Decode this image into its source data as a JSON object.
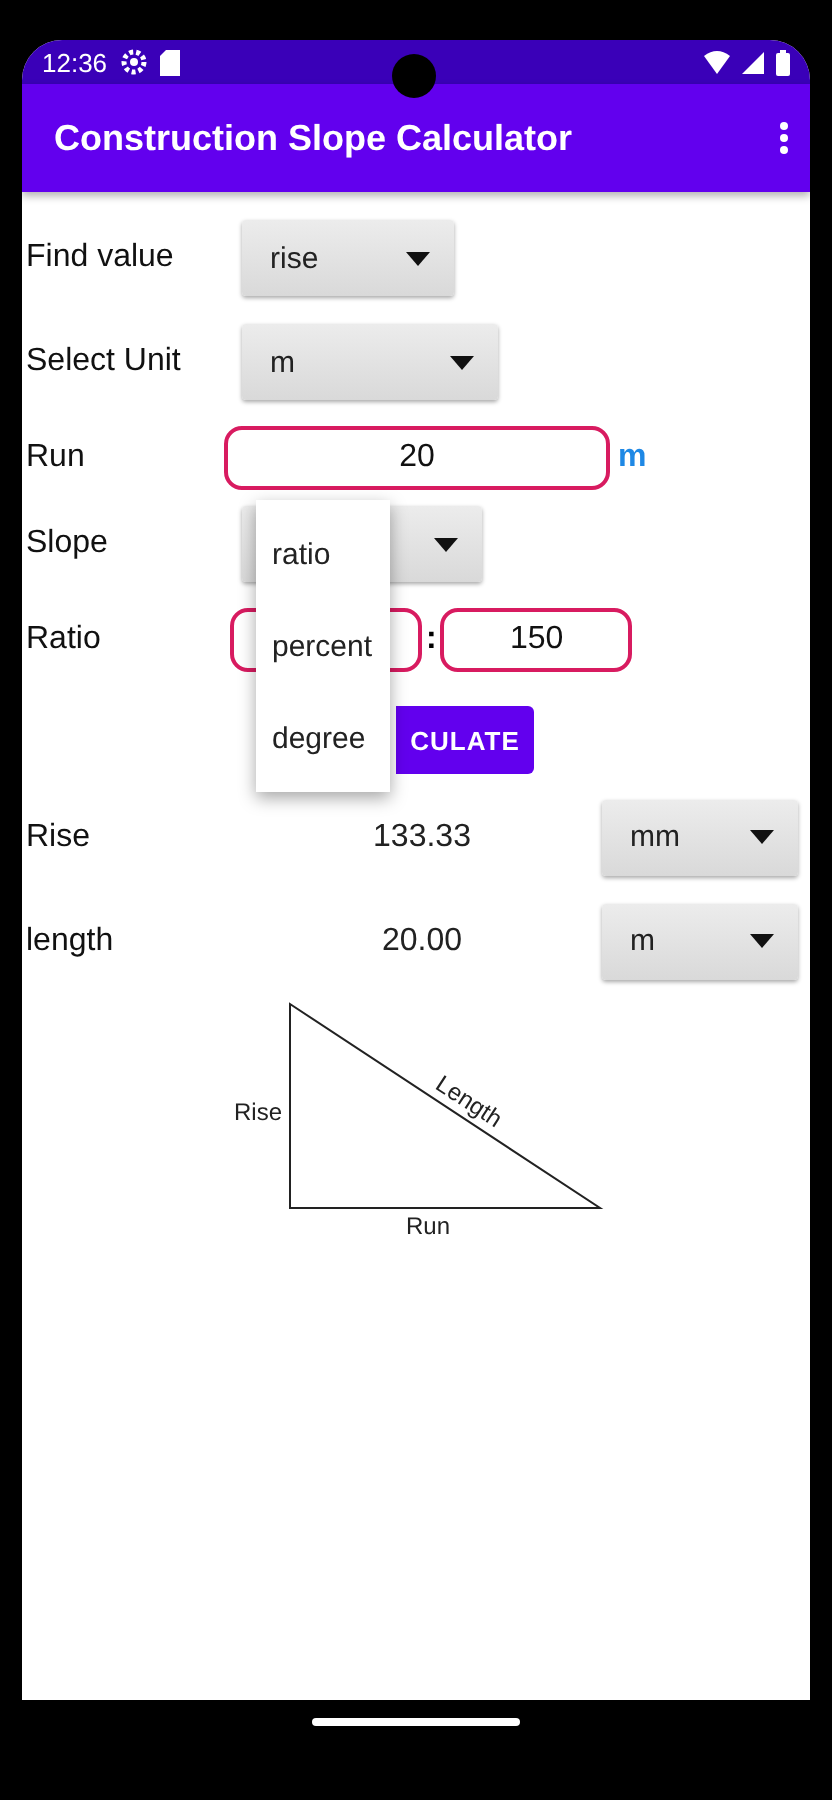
{
  "status_bar": {
    "time": "12:36"
  },
  "app_bar": {
    "title": "Construction Slope Calculator"
  },
  "form": {
    "find_value": {
      "label": "Find value",
      "value": "rise"
    },
    "select_unit": {
      "label": "Select Unit",
      "value": "m"
    },
    "run": {
      "label": "Run",
      "value": "20",
      "unit": "m"
    },
    "slope": {
      "label": "Slope"
    },
    "ratio": {
      "label": "Ratio",
      "separator": ":",
      "value_2": "150"
    },
    "calculate_button": "CULATE"
  },
  "results": [
    {
      "label": "Rise",
      "value": "133.33",
      "unit": "mm"
    },
    {
      "label": "length",
      "value": "20.00",
      "unit": "m"
    }
  ],
  "diagram": {
    "rise": "Rise",
    "length": "Length",
    "run": "Run"
  },
  "dropdown_menu": [
    "ratio",
    "percent",
    "degree"
  ]
}
